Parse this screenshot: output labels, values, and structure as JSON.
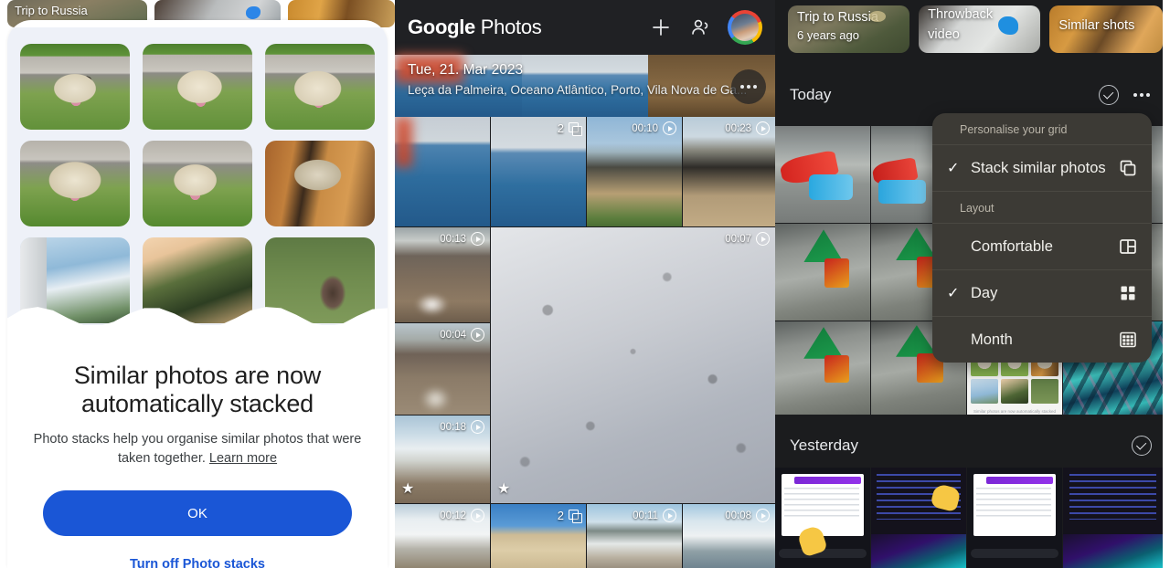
{
  "panel_dialog": {
    "memory_cards": [
      {
        "label": "Trip to Russia"
      },
      {
        "label": ""
      },
      {
        "label": ""
      }
    ],
    "grid_alt": [
      "dog-photo-1",
      "dog-photo-2",
      "dog-photo-3",
      "dog-photo-4",
      "dog-photo-5",
      "dog-photo-6",
      "airplane-window-photo",
      "palm-tree-photo",
      "cat-photo"
    ],
    "title": "Similar photos are now automatically stacked",
    "body_text": "Photo stacks help you organise similar photos that were taken together.",
    "learn_more": "Learn more",
    "ok_label": "OK",
    "turn_off_label": "Turn off Photo stacks",
    "accent_color": "#1a56d6"
  },
  "panel_photos": {
    "app_title_bold": "Google",
    "app_title_light": " Photos",
    "icons": {
      "add": "plus-icon",
      "sharing": "people-icon",
      "account": "account-avatar"
    },
    "date_header": "Tue, 21. Mar 2023",
    "location": "Leça da Palmeira, Oceano Atlântico, Porto, Vila Nova de Ga...",
    "overflow": "more-options-icon",
    "cells": [
      {
        "name": "sea-photo-1",
        "dur": "",
        "stack": "",
        "star": false
      },
      {
        "name": "sea-photo-2",
        "dur": "",
        "stack": "2",
        "star": false
      },
      {
        "name": "rocky-beach-video",
        "dur": "00:10",
        "stack": "",
        "star": false
      },
      {
        "name": "rock-surf-video",
        "dur": "00:23",
        "stack": "",
        "star": false
      },
      {
        "name": "wet-sand-video",
        "dur": "00:13",
        "stack": "",
        "star": false
      },
      {
        "name": "foam-video",
        "dur": "00:07",
        "stack": "",
        "star": true
      },
      {
        "name": "shoreline-video",
        "dur": "00:04",
        "stack": "",
        "star": false
      },
      {
        "name": "beach-wave-video",
        "dur": "00:18",
        "stack": "",
        "star": true
      },
      {
        "name": "surf-video-1",
        "dur": "00:12",
        "stack": "",
        "star": false
      },
      {
        "name": "beach-stack-photo",
        "dur": "",
        "stack": "2",
        "star": false
      },
      {
        "name": "surf-video-2",
        "dur": "00:11",
        "stack": "",
        "star": false
      },
      {
        "name": "surf-video-3",
        "dur": "00:08",
        "stack": "",
        "star": false
      }
    ]
  },
  "panel_menu": {
    "memory_cards": [
      {
        "line1": "Trip to Russia",
        "line2": "6 years ago"
      },
      {
        "line1": "Throwback",
        "line2": "video"
      },
      {
        "line1": "Similar shots",
        "line2": ""
      }
    ],
    "sections": [
      {
        "label": "Today"
      },
      {
        "label": "Yesterday"
      }
    ],
    "section_icons": {
      "select": "circle-check-icon",
      "overflow": "more-options-icon"
    },
    "menu": {
      "group1_title": "Personalise your grid",
      "stack_label": "Stack similar photos",
      "stack_checked": true,
      "stack_icon": "stack-copy-icon",
      "group2_title": "Layout",
      "options": [
        {
          "label": "Comfortable",
          "checked": false,
          "icon": "comfortable-grid-icon"
        },
        {
          "label": "Day",
          "checked": true,
          "icon": "day-grid-icon"
        },
        {
          "label": "Month",
          "checked": false,
          "icon": "month-grid-icon"
        }
      ]
    },
    "today_tiles": [
      "lego-photo-1",
      "lego-photo-2",
      "lego-photo-3",
      "lego-photo-4",
      "lego-photo-5",
      "lego-photo-6",
      "similar-photos-stack-tile",
      "peacock-ships-artwork"
    ],
    "yesterday_tiles": [
      "chat-screenshot-1",
      "chat-screenshot-2",
      "chat-screenshot-3",
      "chat-screenshot-4"
    ],
    "menu_bg_color": "#3c3a35"
  }
}
